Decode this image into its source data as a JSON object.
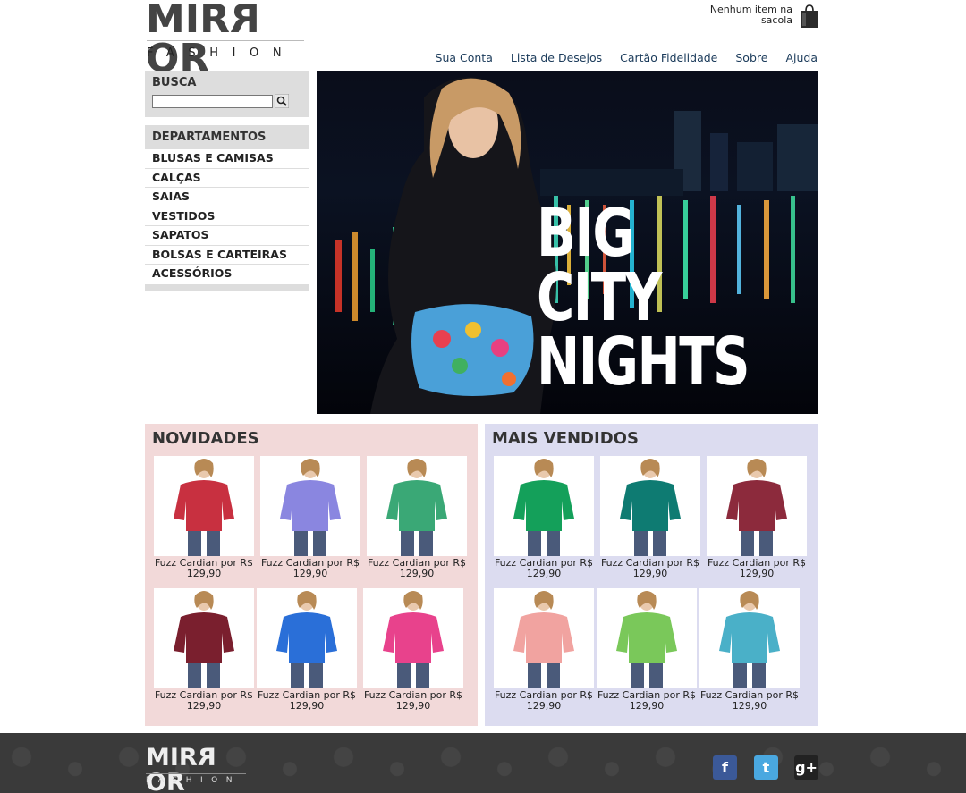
{
  "brand": {
    "name_a": "MIR",
    "name_r": "R",
    "name_b": "OR",
    "sub": "FASHION"
  },
  "cart": {
    "line1": "Nenhum item na",
    "line2": "sacola"
  },
  "nav": [
    "Sua Conta",
    "Lista de Desejos",
    "Cartão Fidelidade",
    "Sobre",
    "Ajuda"
  ],
  "search": {
    "label": "BUSCA",
    "value": "",
    "placeholder": ""
  },
  "departments": {
    "title": "DEPARTAMENTOS",
    "items": [
      "BLUSAS E CAMISAS",
      "CALÇAS",
      "SAIAS",
      "VESTIDOS",
      "SAPATOS",
      "BOLSAS E CARTEIRAS",
      "ACESSÓRIOS"
    ]
  },
  "banner": {
    "line1": "BIG",
    "line2": "CITY",
    "line3": "NIGHTS"
  },
  "novidades": {
    "title": "NOVIDADES",
    "products": [
      {
        "name": "Fuzz Cardian por R$",
        "price": "129,90",
        "color": "#c83040",
        "icon": "jacket-icon"
      },
      {
        "name": "Fuzz Cardian por R$",
        "price": "129,90",
        "color": "#8a86e0",
        "icon": "tshirt-icon"
      },
      {
        "name": "Fuzz Cardian por R$",
        "price": "129,90",
        "color": "#3aa876",
        "icon": "shirt-icon"
      },
      {
        "name": "Fuzz Cardian por R$",
        "price": "129,90",
        "color": "#7a1f2e",
        "icon": "coat-icon"
      },
      {
        "name": "Fuzz Cardian por R$",
        "price": "129,90",
        "color": "#2a6fd8",
        "icon": "tank-top-icon"
      },
      {
        "name": "Fuzz Cardian por R$",
        "price": "129,90",
        "color": "#e8428c",
        "icon": "dress-icon"
      }
    ]
  },
  "mais_vendidos": {
    "title": "MAIS VENDIDOS",
    "products": [
      {
        "name": "Fuzz Cardian por R$",
        "price": "129,90",
        "color": "#14a05a",
        "icon": "tshirt-icon"
      },
      {
        "name": "Fuzz Cardian por R$",
        "price": "129,90",
        "color": "#0e7b72",
        "icon": "tshirt-icon"
      },
      {
        "name": "Fuzz Cardian por R$",
        "price": "129,90",
        "color": "#8c2a3c",
        "icon": "shirt-icon"
      },
      {
        "name": "Fuzz Cardian por R$",
        "price": "129,90",
        "color": "#f1a3a0",
        "icon": "sweater-icon"
      },
      {
        "name": "Fuzz Cardian por R$",
        "price": "129,90",
        "color": "#7ac85a",
        "icon": "shorts-icon"
      },
      {
        "name": "Fuzz Cardian por R$",
        "price": "129,90",
        "color": "#4ab0c8",
        "icon": "shirt-icon"
      }
    ]
  },
  "social": [
    {
      "icon": "facebook-icon",
      "glyph": "f",
      "color": "#3b5998"
    },
    {
      "icon": "twitter-icon",
      "glyph": "t",
      "color": "#4aa8e0"
    },
    {
      "icon": "google-plus-icon",
      "glyph": "g+",
      "color": "#222222"
    }
  ]
}
